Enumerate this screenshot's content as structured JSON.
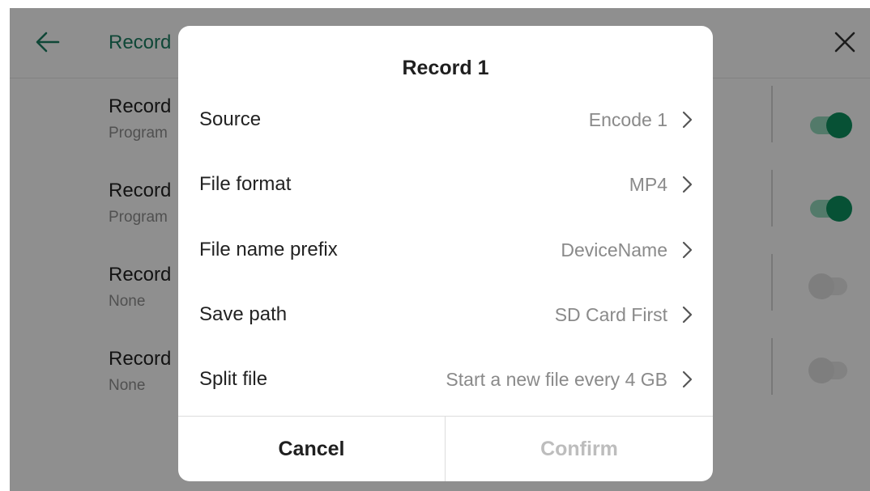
{
  "page": {
    "title": "Record",
    "rows": [
      {
        "title": "Record",
        "subtitle": "Program",
        "toggle_on": true
      },
      {
        "title": "Record",
        "subtitle": "Program",
        "toggle_on": true
      },
      {
        "title": "Record",
        "subtitle": "None",
        "toggle_on": false
      },
      {
        "title": "Record",
        "subtitle": "None",
        "toggle_on": false
      }
    ]
  },
  "dialog": {
    "title": "Record 1",
    "options": [
      {
        "label": "Source",
        "value": "Encode 1"
      },
      {
        "label": "File format",
        "value": "MP4"
      },
      {
        "label": "File name prefix",
        "value": "DeviceName"
      },
      {
        "label": "Save path",
        "value": "SD Card First"
      },
      {
        "label": "Split file",
        "value": "Start a new file every 4 GB"
      }
    ],
    "cancel_label": "Cancel",
    "confirm_label": "Confirm"
  },
  "colors": {
    "accent": "#0d8c5c",
    "title_green": "#1a7a60",
    "disabled_text": "#bdbdbd"
  }
}
